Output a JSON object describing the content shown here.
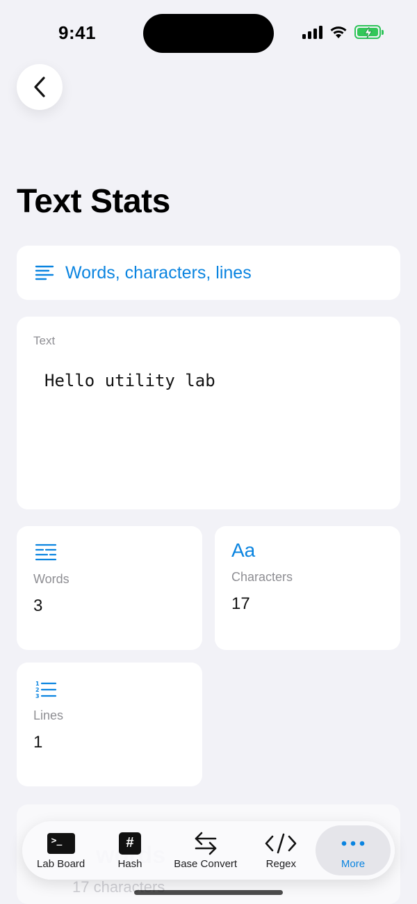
{
  "status_bar": {
    "time": "9:41"
  },
  "page": {
    "title": "Text Stats",
    "subtitle": "Words, characters, lines"
  },
  "input": {
    "label": "Text",
    "value": "Hello utility lab"
  },
  "stats": {
    "words": {
      "label": "Words",
      "value": "3"
    },
    "characters": {
      "label": "Characters",
      "value": "17",
      "icon_text": "Aa"
    },
    "lines": {
      "label": "Lines",
      "value": "1"
    }
  },
  "peek": {
    "big": "words",
    "small": "17 characters"
  },
  "tab_bar": {
    "tabs": [
      {
        "label": "Lab Board",
        "icon": "terminal-icon"
      },
      {
        "label": "Hash",
        "icon": "hash-icon"
      },
      {
        "label": "Base Convert",
        "icon": "arrows-icon"
      },
      {
        "label": "Regex",
        "icon": "code-icon"
      },
      {
        "label": "More",
        "icon": "ellipsis-icon",
        "active": true
      }
    ]
  },
  "colors": {
    "accent": "#0a84e0",
    "background": "#f2f2f7",
    "battery": "#33c759"
  }
}
